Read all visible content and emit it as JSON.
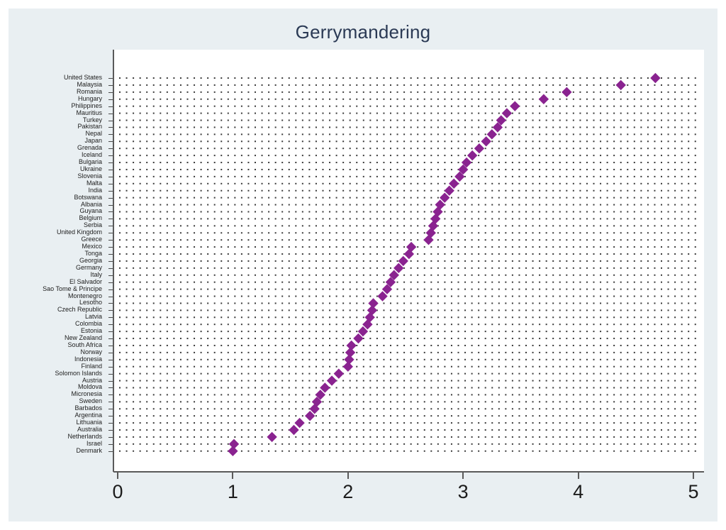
{
  "chart_data": {
    "type": "scatter",
    "title": "Gerrymandering",
    "xlabel": "",
    "ylabel": "",
    "xlim": [
      0,
      5
    ],
    "xticks": [
      0,
      1,
      2,
      3,
      4,
      5
    ],
    "xtick_labels": [
      "0",
      "1",
      "2",
      "3",
      "4",
      "5"
    ],
    "grid": true,
    "grid_style": "dotted",
    "legend": "none",
    "marker": "diamond",
    "marker_color": "#8A2390",
    "orientation": "horizontal-dot-plot",
    "sorted": "descending by value",
    "categories": [
      "United States",
      "Malaysia",
      "Romania",
      "Hungary",
      "Philippines",
      "Mauritius",
      "Turkey",
      "Pakistan",
      "Nepal",
      "Japan",
      "Grenada",
      "Iceland",
      "Bulgaria",
      "Ukraine",
      "Slovenia",
      "Malta",
      "India",
      "Botswana",
      "Albania",
      "Guyana",
      "Belgium",
      "Serbia",
      "United Kingdom",
      "Greece",
      "Mexico",
      "Tonga",
      "Georgia",
      "Germany",
      "Italy",
      "El Salvador",
      "Sao Tome & Principe",
      "Montenegro",
      "Lesotho",
      "Czech Republic",
      "Latvia",
      "Colombia",
      "Estonia",
      "New Zealand",
      "South Africa",
      "Norway",
      "Indonesia",
      "Finland",
      "Solomon Islands",
      "Austria",
      "Moldova",
      "Micronesia",
      "Sweden",
      "Barbados",
      "Argentina",
      "Lithuania",
      "Australia",
      "Netherlands",
      "Israel",
      "Denmark"
    ],
    "values": [
      4.67,
      4.37,
      3.9,
      3.7,
      3.45,
      3.38,
      3.33,
      3.3,
      3.25,
      3.2,
      3.14,
      3.08,
      3.03,
      3.0,
      2.97,
      2.92,
      2.88,
      2.84,
      2.8,
      2.78,
      2.76,
      2.74,
      2.72,
      2.7,
      2.55,
      2.53,
      2.48,
      2.44,
      2.4,
      2.37,
      2.34,
      2.3,
      2.22,
      2.21,
      2.19,
      2.17,
      2.13,
      2.09,
      2.03,
      2.02,
      2.01,
      2.0,
      1.92,
      1.86,
      1.8,
      1.76,
      1.73,
      1.71,
      1.67,
      1.58,
      1.53,
      1.34,
      1.01,
      1.0
    ]
  },
  "axes": {
    "x_tick_labels": [
      "0",
      "1",
      "2",
      "3",
      "4",
      "5"
    ]
  }
}
